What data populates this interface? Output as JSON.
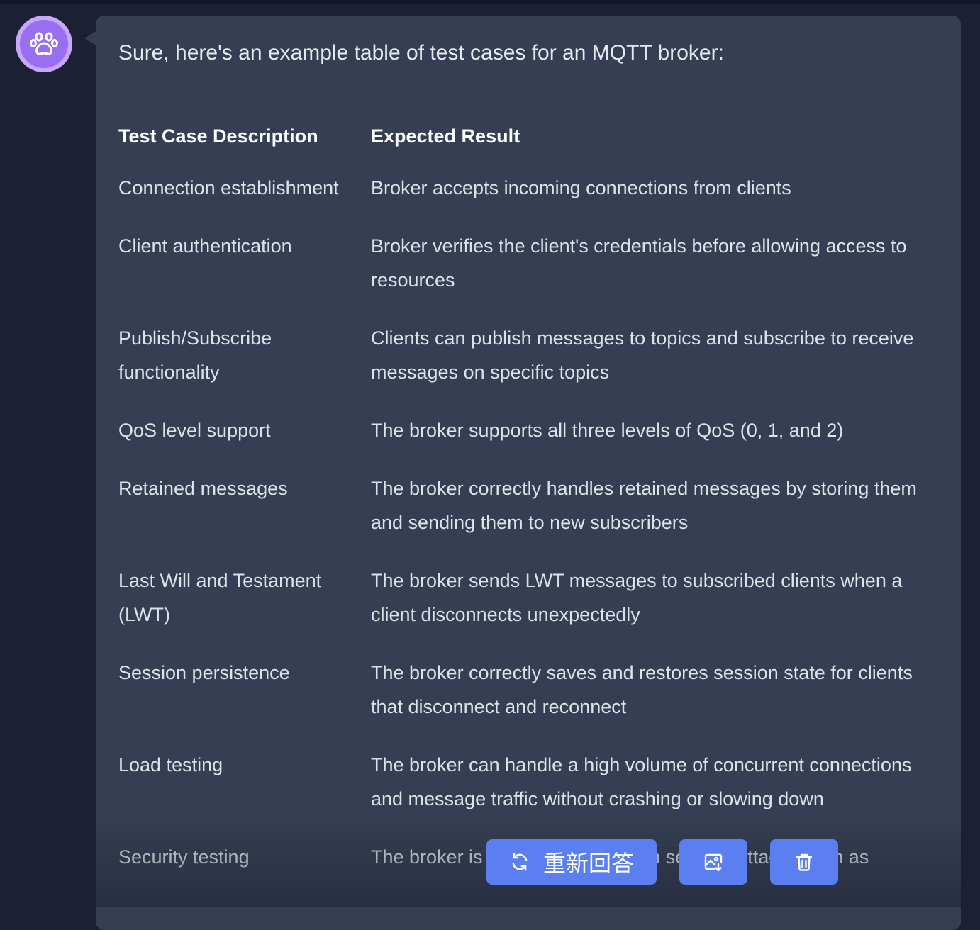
{
  "chat": {
    "intro": "Sure, here's an example table of test cases for an MQTT broker:",
    "table": {
      "headers": [
        "Test Case Description",
        "Expected Result"
      ],
      "rows": [
        [
          "Connection establishment",
          "Broker accepts incoming connections from clients"
        ],
        [
          "Client authentication",
          "Broker verifies the client's credentials before allowing access to resources"
        ],
        [
          "Publish/Subscribe functionality",
          "Clients can publish messages to topics and subscribe to receive messages on specific topics"
        ],
        [
          "QoS level support",
          "The broker supports all three levels of QoS (0, 1, and 2)"
        ],
        [
          "Retained messages",
          "The broker correctly handles retained messages by storing them and sending them to new subscribers"
        ],
        [
          "Last Will and Testament (LWT)",
          "The broker sends LWT messages to subscribed clients when a client disconnects unexpectedly"
        ],
        [
          "Session persistence",
          "The broker correctly saves and restores session state for clients that disconnect and reconnect"
        ],
        [
          "Load testing",
          "The broker can handle a high volume of concurrent connections and message traffic without crashing or slowing down"
        ],
        [
          "Security testing",
          "The broker is resistant to common security attacks such as"
        ]
      ]
    }
  },
  "actions": {
    "regenerate_label": "重新回答",
    "regenerate_icon": "refresh-icon",
    "image_icon": "image-export-icon",
    "delete_icon": "trash-icon"
  },
  "colors": {
    "background": "#1b2034",
    "bubble": "#353e52",
    "button": "#5b7ff0",
    "avatar": "#9a6ef0"
  }
}
